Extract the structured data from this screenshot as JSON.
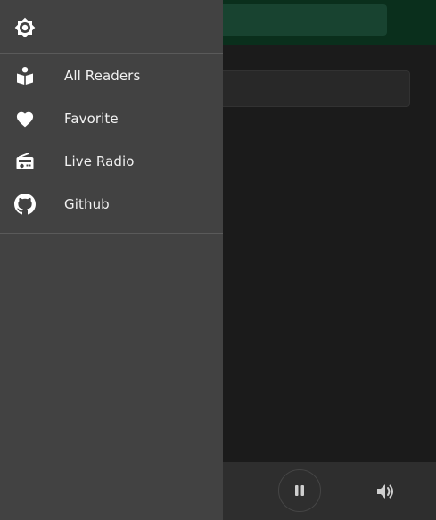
{
  "drawer": {
    "items": [
      {
        "label": "All Readers",
        "icon": "reader-book-icon"
      },
      {
        "label": "Favorite",
        "icon": "heart-icon"
      },
      {
        "label": "Live Radio",
        "icon": "radio-icon"
      },
      {
        "label": "Github",
        "icon": "github-icon"
      }
    ]
  },
  "colors": {
    "drawer_bg": "#424242",
    "app_bg": "#1b1b1b",
    "topbar_bg": "#0a2f1c",
    "player_bg": "#2e2e2e"
  }
}
